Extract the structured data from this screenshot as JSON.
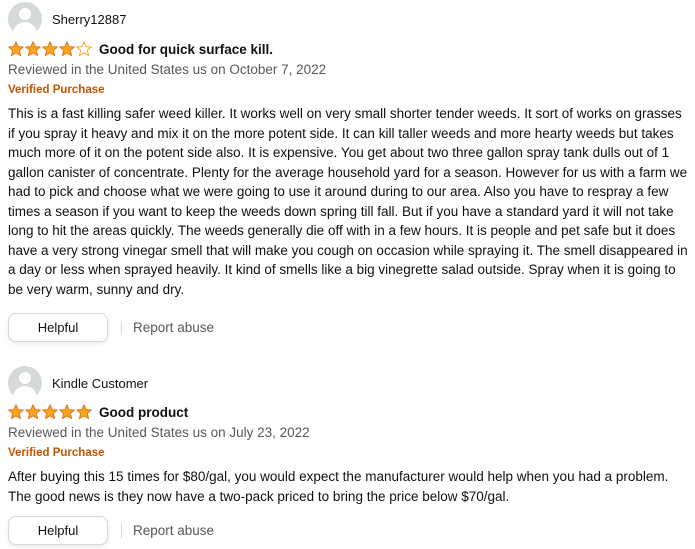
{
  "colors": {
    "star": "#ffa41c",
    "verified": "#c45500",
    "muted_text": "#565959"
  },
  "reviews": [
    {
      "profile_name": "Sherry12887",
      "rating": 4,
      "rating_max": 5,
      "title": "Good for quick surface kill.",
      "date": "Reviewed in the United States us on October 7, 2022",
      "verified": "Verified Purchase",
      "body": "This is a fast killing safer weed killer. It works well on very small shorter tender weeds. It sort of works on grasses if you spray it heavy and mix it on the more potent side. It can kill taller weeds and more hearty weeds but takes much more of it on the potent side also. It is expensive. You get about two three gallon spray tank dulls out of 1 gallon canister of concentrate. Plenty for the average household yard for a season. However for us with a farm we had to pick and choose what we were going to use it around during to our area. Also you have to respray a few times a season if you want to keep the weeds down spring till fall. But if you have a standard yard it will not take long to hit the areas quickly. The weeds generally die off with in a few hours. It is people and pet safe but it does have a very strong vinegar smell that will make you cough on occasion while spraying it. The smell disappeared in a day or less when sprayed heavily. It kind of smells like a big vinegrette salad outside. Spray when it is going to be very warm, sunny and dry.",
      "helpful_label": "Helpful",
      "report_label": "Report abuse"
    },
    {
      "profile_name": "Kindle Customer",
      "rating": 5,
      "rating_max": 5,
      "title": "Good product",
      "date": "Reviewed in the United States us on July 23, 2022",
      "verified": "Verified Purchase",
      "body": "After buying this 15 times for $80/gal, you would expect the manufacturer would help when you had a problem. The good news is they now have a two-pack priced to bring the price below $70/gal.",
      "helpful_label": "Helpful",
      "report_label": "Report abuse"
    }
  ]
}
